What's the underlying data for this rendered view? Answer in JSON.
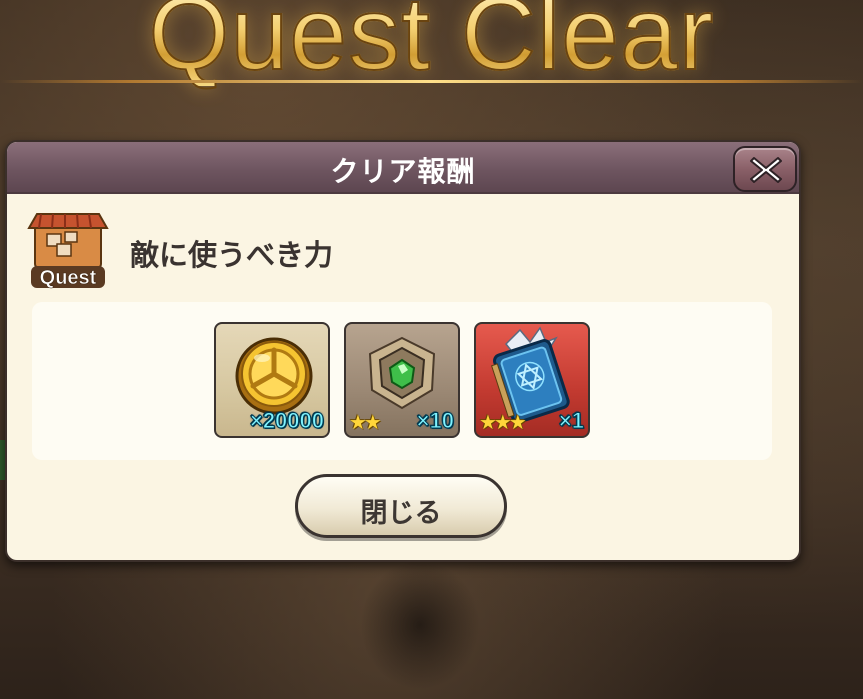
{
  "screen": {
    "title": "Quest Clear"
  },
  "dialog": {
    "title": "クリア報酬",
    "quest_badge_label": "Quest",
    "quest_name": "敵に使うべき力",
    "close_button_label": "閉じる"
  },
  "rewards": [
    {
      "type": "gold-coin",
      "quantity": "×20000",
      "stars": ""
    },
    {
      "type": "green-gem-stone",
      "quantity": "×10",
      "stars": "★★"
    },
    {
      "type": "blue-spell-book",
      "quantity": "×1",
      "stars": "★★★"
    }
  ],
  "colors": {
    "header": "#6e5560",
    "panel": "#fbf5e3",
    "quantity_text": "#7ff3ff",
    "star": "#ffd63a",
    "title_gold": "#f2d27a"
  }
}
